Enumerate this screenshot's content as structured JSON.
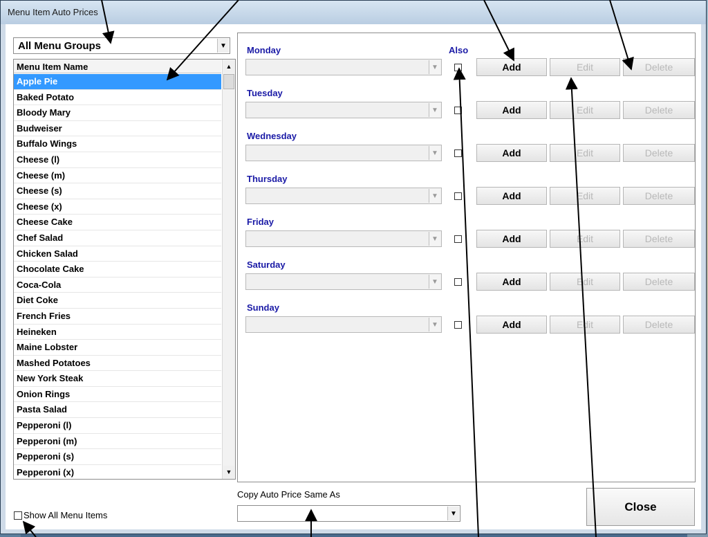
{
  "window": {
    "title": "Menu Item Auto Prices"
  },
  "groups_combo": {
    "value": "All Menu Groups"
  },
  "item_list": {
    "header": "Menu Item Name",
    "items": [
      "Apple Pie",
      "Baked Potato",
      "Bloody Mary",
      "Budweiser",
      "Buffalo Wings",
      "Cheese (l)",
      "Cheese (m)",
      "Cheese (s)",
      "Cheese (x)",
      "Cheese Cake",
      "Chef Salad",
      "Chicken Salad",
      "Chocolate Cake",
      "Coca-Cola",
      "Diet Coke",
      "French Fries",
      "Heineken",
      "Maine Lobster",
      "Mashed Potatoes",
      "New York Steak",
      "Onion Rings",
      "Pasta Salad",
      "Pepperoni (l)",
      "Pepperoni (m)",
      "Pepperoni (s)",
      "Pepperoni (x)"
    ],
    "selected": "Apple Pie"
  },
  "schedule": {
    "also_label": "Also",
    "days": [
      "Monday",
      "Tuesday",
      "Wednesday",
      "Thursday",
      "Friday",
      "Saturday",
      "Sunday"
    ],
    "add_label": "Add",
    "edit_label": "Edit",
    "delete_label": "Delete"
  },
  "copy": {
    "label": "Copy Auto Price Same As",
    "value": ""
  },
  "show_all": {
    "label": "Show All Menu Items",
    "checked": false
  },
  "close_label": "Close",
  "icons": {
    "dropdown": "chevron-down-icon",
    "scroll_up": "arrow-up-icon",
    "scroll_down": "arrow-down-icon"
  }
}
